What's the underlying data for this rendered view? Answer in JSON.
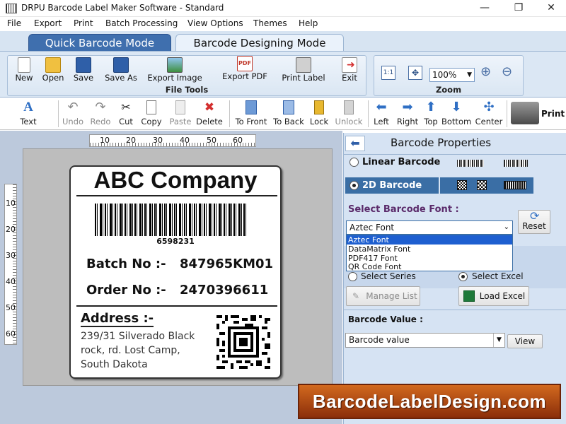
{
  "window": {
    "title": "DRPU Barcode Label Maker Software - Standard",
    "minimize": "—",
    "maximize": "❐",
    "close": "✕"
  },
  "menu": [
    "File",
    "Export",
    "Print",
    "Batch Processing",
    "View Options",
    "Themes",
    "Help"
  ],
  "mode_tabs": {
    "quick": "Quick Barcode Mode",
    "design": "Barcode Designing Mode"
  },
  "ribbon": {
    "file_tools": {
      "label": "File Tools",
      "buttons": [
        "New",
        "Open",
        "Save",
        "Save As",
        "Export Image",
        "Export PDF",
        "Print Label",
        "Exit"
      ]
    },
    "zoom": {
      "label": "Zoom",
      "value": "100%"
    }
  },
  "toolbar": [
    "Text",
    "Undo",
    "Redo",
    "Cut",
    "Copy",
    "Paste",
    "Delete",
    "To Front",
    "To Back",
    "Lock",
    "Unlock",
    "Left",
    "Right",
    "Top",
    "Bottom",
    "Center",
    "Print"
  ],
  "rulers": {
    "h": [
      "10",
      "20",
      "30",
      "40",
      "50",
      "60"
    ],
    "v": [
      "10",
      "20",
      "30",
      "40",
      "50",
      "60"
    ]
  },
  "label": {
    "company": "ABC Company",
    "barcode_number": "6598231",
    "batch_label": "Batch No :-",
    "batch_value": "847965KM01",
    "order_label": "Order No :-",
    "order_value": "2470396611",
    "address_label": "Address :-",
    "address_lines": [
      "239/31 Silverado Black",
      "rock, rd. Lost Camp,",
      "South Dakota"
    ]
  },
  "panel": {
    "title": "Barcode Properties",
    "linear": "Linear Barcode",
    "twod": "2D Barcode",
    "select_font_label": "Select Barcode Font :",
    "font_selected": "Aztec Font",
    "font_options": [
      "Aztec Font",
      "DataMatrix Font",
      "PDF417 Font",
      "QR Code Font"
    ],
    "reset": "Reset",
    "select_series": "Select Series",
    "select_excel": "Select Excel",
    "manage_list": "Manage List",
    "load_excel": "Load Excel",
    "barcode_value_label": "Barcode Value :",
    "barcode_value_placeholder": "Barcode value",
    "view": "View"
  },
  "watermark": "BarcodeLabelDesign.com",
  "colors": {
    "accent": "#3f6fae",
    "ribbon_bg": "#dbe7f4",
    "panel_bg": "#d6e3f3",
    "selected_row": "#3a6ea5",
    "watermark": "#c0581a"
  }
}
